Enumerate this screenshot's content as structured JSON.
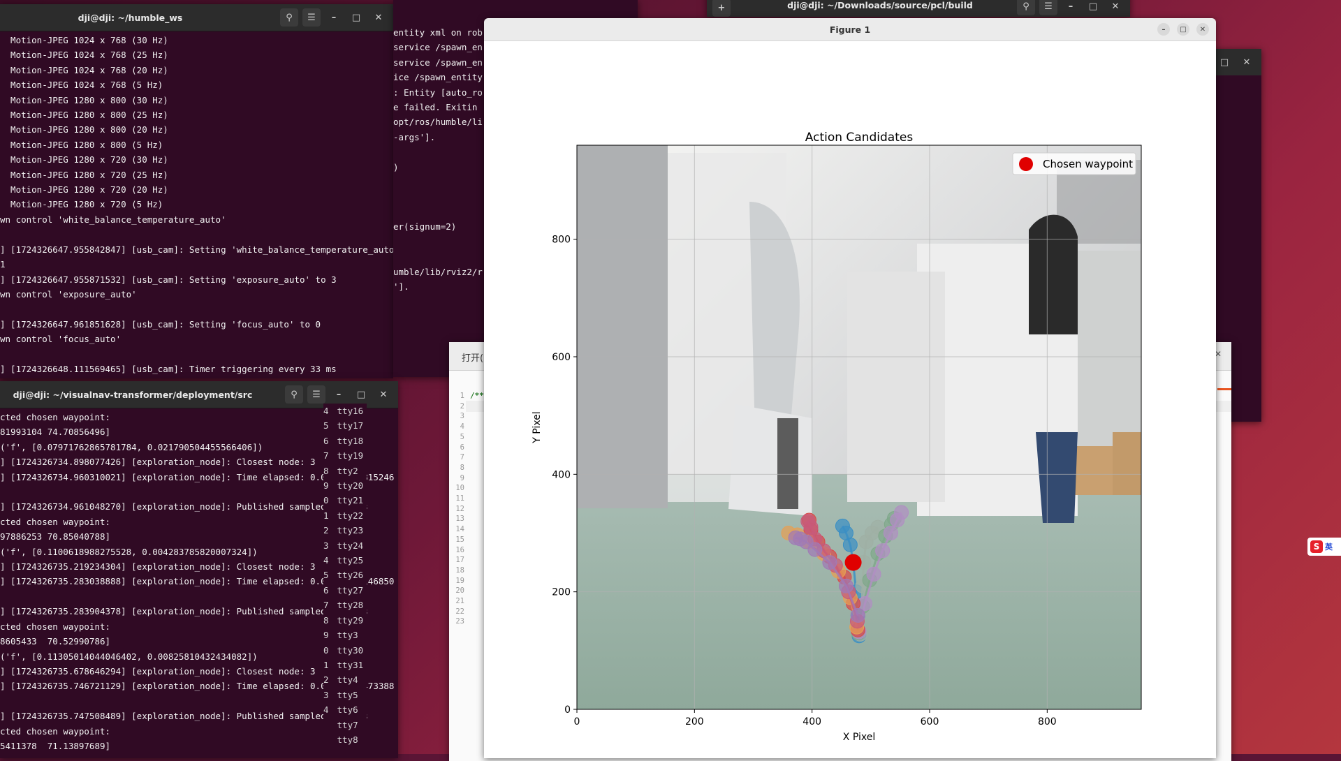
{
  "terminal_top": {
    "title": "dji@dji: ~/humble_ws",
    "lines": [
      "  Motion-JPEG 1024 x 768 (30 Hz)",
      "  Motion-JPEG 1024 x 768 (25 Hz)",
      "  Motion-JPEG 1024 x 768 (20 Hz)",
      "  Motion-JPEG 1024 x 768 (5 Hz)",
      "  Motion-JPEG 1280 x 800 (30 Hz)",
      "  Motion-JPEG 1280 x 800 (25 Hz)",
      "  Motion-JPEG 1280 x 800 (20 Hz)",
      "  Motion-JPEG 1280 x 800 (5 Hz)",
      "  Motion-JPEG 1280 x 720 (30 Hz)",
      "  Motion-JPEG 1280 x 720 (25 Hz)",
      "  Motion-JPEG 1280 x 720 (20 Hz)",
      "  Motion-JPEG 1280 x 720 (5 Hz)",
      "wn control 'white_balance_temperature_auto'",
      "",
      "] [1724326647.955842847] [usb_cam]: Setting 'white_balance_temperature_auto",
      "1",
      "] [1724326647.955871532] [usb_cam]: Setting 'exposure_auto' to 3",
      "wn control 'exposure_auto'",
      "",
      "] [1724326647.961851628] [usb_cam]: Setting 'focus_auto' to 0",
      "wn control 'focus_auto'",
      "",
      "] [1724326648.111569465] [usb_cam]: Timer triggering every 33 ms"
    ]
  },
  "terminal_bottom": {
    "title": "dji@dji: ~/visualnav-transformer/deployment/src",
    "lines": [
      "cted chosen waypoint:",
      "81993104 74.70856496]",
      "('f', [0.07971762865781784, 0.021790504455566406])",
      "] [1724326734.898077426] [exploration_node]: Closest node: 3",
      "] [1724326734.960310021] [exploration_node]: Time elapsed: 0.06151127815246",
      "",
      "] [1724326734.961048270] [exploration_node]: Published sampled actions",
      "cted chosen waypoint:",
      "97886253 70.85040788]",
      "('f', [0.1100618988275528, 0.004283785820007324])",
      "] [1724326735.219234304] [exploration_node]: Closest node: 3",
      "] [1724326735.283038888] [exploration_node]: Time elapsed: 0.06311941146850",
      "",
      "] [1724326735.283904378] [exploration_node]: Published sampled actions",
      "cted chosen waypoint:",
      "8605433  70.52990786]",
      "('f', [0.11305014044046402, 0.00825810432434082])",
      "] [1724326735.678646294] [exploration_node]: Closest node: 3",
      "] [1724326735.746721129] [exploration_node]: Time elapsed: 0.06737041473388",
      "",
      "] [1724326735.747508489] [exploration_node]: Published sampled actions",
      "cted chosen waypoint:",
      "5411378  71.13897689]"
    ]
  },
  "terminal_mid": {
    "lines": [
      "entity xml on rob",
      "service /spawn_en",
      "service /spawn_en",
      "ice /spawn_entity",
      ": Entity [auto_ro",
      "e failed. Exitin",
      "opt/ros/humble/li",
      "-args'].",
      "",
      ")",
      "",
      "",
      "",
      "er(signum=2)",
      "",
      "",
      "umble/lib/rviz2/r",
      "']."
    ]
  },
  "terminal_right": {
    "title": "dji@dji: ~/Downloads/source/pcl/build"
  },
  "editor": {
    "tab_label": "打开(",
    "first_line": "/**",
    "line_numbers": [
      "1",
      "2",
      "3",
      "4",
      "5",
      "6",
      "7",
      "8",
      "9",
      "10",
      "11",
      "12",
      "13",
      "14",
      "15",
      "16",
      "17",
      "18",
      "19",
      "20",
      "21",
      "22",
      "23"
    ]
  },
  "tty_list": {
    "prefix": [
      "4",
      "5",
      "6",
      "7",
      "8",
      "9",
      "0",
      "1",
      "2",
      "3",
      "4",
      "5",
      "6",
      "7",
      "8",
      "9",
      "0",
      "1",
      "2",
      "3",
      "4"
    ],
    "items": [
      "tty16",
      "tty17",
      "tty18",
      "tty19",
      "tty2",
      "tty20",
      "tty21",
      "tty22",
      "tty23",
      "tty24",
      "tty25",
      "tty26",
      "tty27",
      "tty28",
      "tty29",
      "tty3",
      "tty30",
      "tty31",
      "tty4",
      "tty5",
      "tty6",
      "tty7",
      "tty8"
    ]
  },
  "figure": {
    "title": "Figure 1"
  },
  "ime": {
    "label": "英"
  },
  "chart_data": {
    "type": "scatter",
    "title": "Action Candidates",
    "xlabel": "X Pixel",
    "ylabel": "Y Pixel",
    "xlim": [
      0,
      960
    ],
    "ylim": [
      0,
      960
    ],
    "xticks": [
      0,
      200,
      400,
      600,
      800
    ],
    "yticks": [
      0,
      200,
      400,
      600,
      800
    ],
    "grid": true,
    "legend_position": "top-right",
    "background": "camera image of an office with chairs, desks and a person",
    "legend": [
      {
        "name": "Chosen waypoint",
        "color": "#e00000"
      }
    ],
    "chosen_waypoint": {
      "x": 470,
      "y": 250
    },
    "trajectories": [
      {
        "color": "#3b8fc4",
        "points": [
          [
            480,
            125
          ],
          [
            478,
            160
          ],
          [
            475,
            200
          ],
          [
            470,
            250
          ],
          [
            465,
            280
          ],
          [
            458,
            300
          ],
          [
            452,
            312
          ]
        ]
      },
      {
        "color": "#9fb0a5",
        "points": [
          [
            482,
            128
          ],
          [
            484,
            170
          ],
          [
            486,
            210
          ],
          [
            488,
            250
          ],
          [
            492,
            285
          ],
          [
            502,
            300
          ],
          [
            512,
            310
          ]
        ]
      },
      {
        "color": "#7fa88a",
        "points": [
          [
            479,
            130
          ],
          [
            486,
            175
          ],
          [
            498,
            220
          ],
          [
            512,
            265
          ],
          [
            525,
            295
          ],
          [
            535,
            315
          ],
          [
            540,
            325
          ]
        ]
      },
      {
        "color": "#b08fc2",
        "points": [
          [
            480,
            132
          ],
          [
            490,
            180
          ],
          [
            505,
            230
          ],
          [
            520,
            270
          ],
          [
            534,
            300
          ],
          [
            545,
            322
          ],
          [
            552,
            335
          ]
        ]
      },
      {
        "color": "#d84848",
        "points": [
          [
            478,
            135
          ],
          [
            470,
            180
          ],
          [
            455,
            225
          ],
          [
            430,
            260
          ],
          [
            410,
            285
          ],
          [
            398,
            305
          ],
          [
            395,
            322
          ]
        ]
      },
      {
        "color": "#e6a055",
        "points": [
          [
            476,
            140
          ],
          [
            465,
            190
          ],
          [
            445,
            235
          ],
          [
            420,
            265
          ],
          [
            395,
            285
          ],
          [
            375,
            297
          ],
          [
            360,
            300
          ]
        ]
      },
      {
        "color": "#c85a7a",
        "points": [
          [
            477,
            150
          ],
          [
            462,
            200
          ],
          [
            440,
            245
          ],
          [
            420,
            270
          ],
          [
            405,
            290
          ],
          [
            398,
            310
          ],
          [
            393,
            320
          ]
        ]
      },
      {
        "color": "#a07ab5",
        "points": [
          [
            478,
            160
          ],
          [
            458,
            210
          ],
          [
            430,
            250
          ],
          [
            405,
            272
          ],
          [
            390,
            285
          ],
          [
            380,
            290
          ],
          [
            372,
            292
          ]
        ]
      }
    ]
  }
}
